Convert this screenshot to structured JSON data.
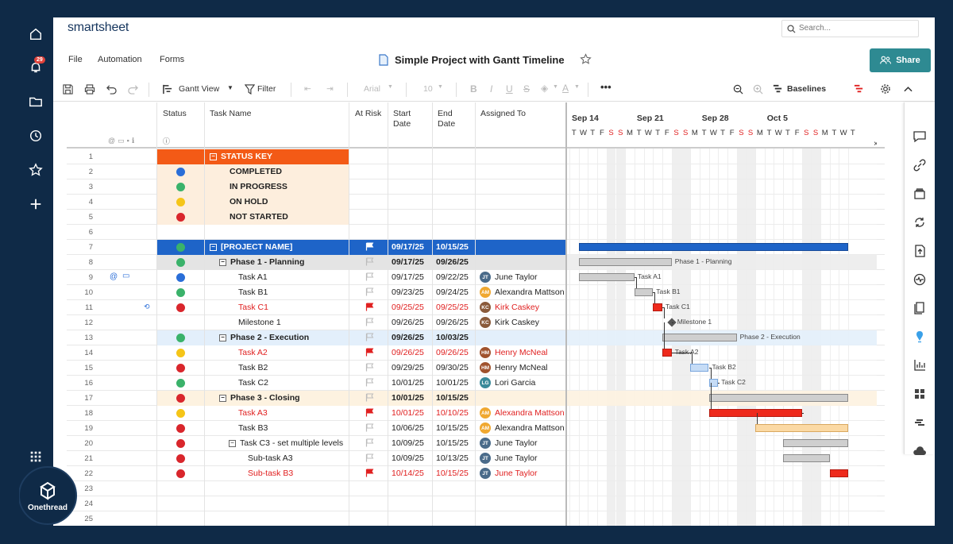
{
  "brand": "smartsheet",
  "nav": {
    "badge": "29"
  },
  "logo_text": "Onethread",
  "search": {
    "placeholder": "Search..."
  },
  "menu": {
    "file": "File",
    "automation": "Automation",
    "forms": "Forms"
  },
  "sheet_title": "Simple Project with Gantt Timeline",
  "share_label": "Share",
  "toolbar": {
    "gantt_view": "Gantt View",
    "filter": "Filter",
    "font": "Arial",
    "font_size": "10",
    "baselines": "Baselines"
  },
  "columns": {
    "status": "Status",
    "task_name": "Task Name",
    "at_risk": "At Risk",
    "start_date": "Start Date",
    "end_date": "End Date",
    "assigned_to": "Assigned To"
  },
  "colors": {
    "blue": "#2a6ed8",
    "green": "#3ab26a",
    "yellow": "#f5c518",
    "red": "#d9262c",
    "header_orange": "#f35a16",
    "key_bg": "#fdeedd",
    "project_blue": "#1e64c8",
    "phase_gray": "#e4e4e4",
    "phase2_bg": "#e3effb",
    "phase3_bg": "#fdf2e0"
  },
  "rows": [
    {
      "n": "1",
      "status": "",
      "task": "STATUS KEY",
      "style": "key-header"
    },
    {
      "n": "2",
      "status": "blue",
      "task": "COMPLETED",
      "style": "key"
    },
    {
      "n": "3",
      "status": "green",
      "task": "IN PROGRESS",
      "style": "key"
    },
    {
      "n": "4",
      "status": "yellow",
      "task": "ON HOLD",
      "style": "key"
    },
    {
      "n": "5",
      "status": "red",
      "task": "NOT STARTED",
      "style": "key"
    },
    {
      "n": "6",
      "status": "",
      "task": "",
      "style": "empty"
    },
    {
      "n": "7",
      "status": "green",
      "task": "[PROJECT NAME]",
      "start": "09/17/25",
      "end": "10/15/25",
      "style": "project"
    },
    {
      "n": "8",
      "status": "green",
      "task": "Phase 1 - Planning",
      "start": "09/17/25",
      "end": "09/26/25",
      "style": "phase1"
    },
    {
      "n": "9",
      "status": "blue",
      "task": "Task A1",
      "start": "09/17/25",
      "end": "09/22/25",
      "assignee": "June Taylor",
      "initials": "JT",
      "av": "#4a6b8a",
      "style": "task"
    },
    {
      "n": "10",
      "status": "green",
      "task": "Task B1",
      "start": "09/23/25",
      "end": "09/24/25",
      "assignee": "Alexandra Mattson",
      "initials": "AM",
      "av": "#f0a830",
      "style": "task"
    },
    {
      "n": "11",
      "status": "red",
      "task": "Task C1",
      "start": "09/25/25",
      "end": "09/25/25",
      "assignee": "Kirk Caskey",
      "initials": "KC",
      "av": "#8a5a3a",
      "style": "task",
      "risk": true
    },
    {
      "n": "12",
      "status": "",
      "task": "Milestone 1",
      "start": "09/26/25",
      "end": "09/26/25",
      "assignee": "Kirk Caskey",
      "initials": "KC",
      "av": "#8a5a3a",
      "style": "task"
    },
    {
      "n": "13",
      "status": "green",
      "task": "Phase 2 - Execution",
      "start": "09/26/25",
      "end": "10/03/25",
      "style": "phase2"
    },
    {
      "n": "14",
      "status": "yellow",
      "task": "Task A2",
      "start": "09/26/25",
      "end": "09/26/25",
      "assignee": "Henry McNeal",
      "initials": "HM",
      "av": "#a0522d",
      "style": "task",
      "risk": true
    },
    {
      "n": "15",
      "status": "red",
      "task": "Task B2",
      "start": "09/29/25",
      "end": "09/30/25",
      "assignee": "Henry McNeal",
      "initials": "HM",
      "av": "#a0522d",
      "style": "task"
    },
    {
      "n": "16",
      "status": "green",
      "task": "Task C2",
      "start": "10/01/25",
      "end": "10/01/25",
      "assignee": "Lori Garcia",
      "initials": "LG",
      "av": "#3a8a9a",
      "style": "task"
    },
    {
      "n": "17",
      "status": "red",
      "task": "Phase 3 - Closing",
      "start": "10/01/25",
      "end": "10/15/25",
      "style": "phase3"
    },
    {
      "n": "18",
      "status": "yellow",
      "task": "Task A3",
      "start": "10/01/25",
      "end": "10/10/25",
      "assignee": "Alexandra Mattson",
      "initials": "AM",
      "av": "#f0a830",
      "style": "task",
      "risk": true
    },
    {
      "n": "19",
      "status": "red",
      "task": "Task B3",
      "start": "10/06/25",
      "end": "10/15/25",
      "assignee": "Alexandra Mattson",
      "initials": "AM",
      "av": "#f0a830",
      "style": "task"
    },
    {
      "n": "20",
      "status": "red",
      "task": "Task C3 - set multiple levels",
      "start": "10/09/25",
      "end": "10/15/25",
      "assignee": "June Taylor",
      "initials": "JT",
      "av": "#4a6b8a",
      "style": "sub-parent"
    },
    {
      "n": "21",
      "status": "red",
      "task": "Sub-task A3",
      "start": "10/09/25",
      "end": "10/13/25",
      "assignee": "June Taylor",
      "initials": "JT",
      "av": "#4a6b8a",
      "style": "subtask"
    },
    {
      "n": "22",
      "status": "red",
      "task": "Sub-task B3",
      "start": "10/14/25",
      "end": "10/15/25",
      "assignee": "June Taylor",
      "initials": "JT",
      "av": "#4a6b8a",
      "style": "subtask",
      "risk": true
    },
    {
      "n": "23",
      "status": "",
      "task": "",
      "style": "empty"
    },
    {
      "n": "24",
      "status": "",
      "task": "",
      "style": "empty"
    },
    {
      "n": "25",
      "status": "",
      "task": "",
      "style": "empty"
    }
  ],
  "gantt": {
    "weeks": [
      "Sep 14",
      "Sep 21",
      "Sep 28",
      "Oct 5"
    ],
    "days": [
      "T",
      "W",
      "T",
      "F",
      "S",
      "S",
      "M",
      "T",
      "W",
      "T",
      "F",
      "S",
      "S",
      "M",
      "T",
      "W",
      "T",
      "F",
      "S",
      "S",
      "M",
      "T",
      "W",
      "T",
      "F",
      "S",
      "S",
      "M",
      "T",
      "W",
      "T"
    ],
    "bar_labels": {
      "phase1": "Phase 1 - Planning",
      "a1": "Task A1",
      "b1": "Task B1",
      "c1": "Task C1",
      "m1": "Milestone 1",
      "phase2": "Phase 2 - Execution",
      "a2": "Task A2",
      "b2": "Task B2",
      "c2": "Task C2"
    }
  }
}
